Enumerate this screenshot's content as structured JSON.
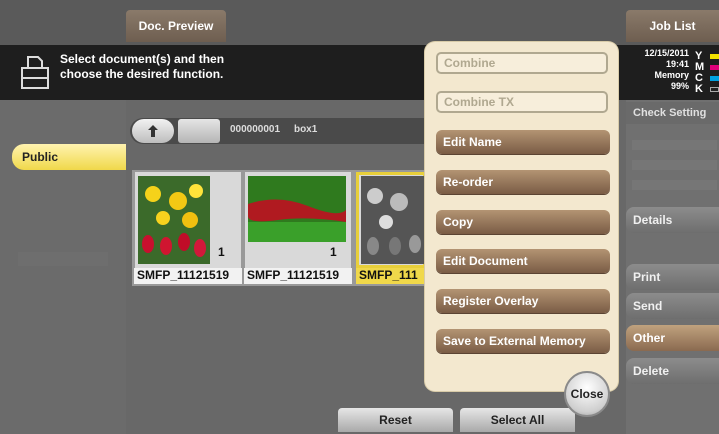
{
  "header": {
    "doc_preview_tab": "Doc. Preview",
    "job_list_tab": "Job List"
  },
  "message": {
    "line1": "Select document(s) and then",
    "line2": "choose the desired function."
  },
  "status": {
    "date": "12/15/2011",
    "time": "19:41",
    "memory_label": "Memory",
    "memory_value": "99%",
    "toner": [
      "Y",
      "M",
      "C",
      "K"
    ],
    "toner_colors": [
      "#f2e200",
      "#e0007a",
      "#00a0e0",
      "#222222"
    ]
  },
  "left": {
    "public_tab": "Public"
  },
  "path": {
    "box_number": "000000001",
    "box_name": "box1"
  },
  "thumbnails": [
    {
      "name": "SMFP_11121519",
      "count": "1"
    },
    {
      "name": "SMFP_11121519",
      "count": "1"
    },
    {
      "name": "SMFP_111",
      "count": ""
    }
  ],
  "bottom": {
    "reset": "Reset",
    "select_all": "Select All"
  },
  "popup": {
    "disabled": [
      "Combine",
      "Combine TX"
    ],
    "actions": [
      "Edit Name",
      "Re-order",
      "Copy",
      "Edit Document",
      "Register Overlay",
      "Save to External Memory"
    ],
    "close": "Close"
  },
  "right": {
    "check_setting": "Check Setting",
    "details": "Details",
    "print": "Print",
    "send": "Send",
    "other": "Other",
    "delete": "Delete"
  }
}
